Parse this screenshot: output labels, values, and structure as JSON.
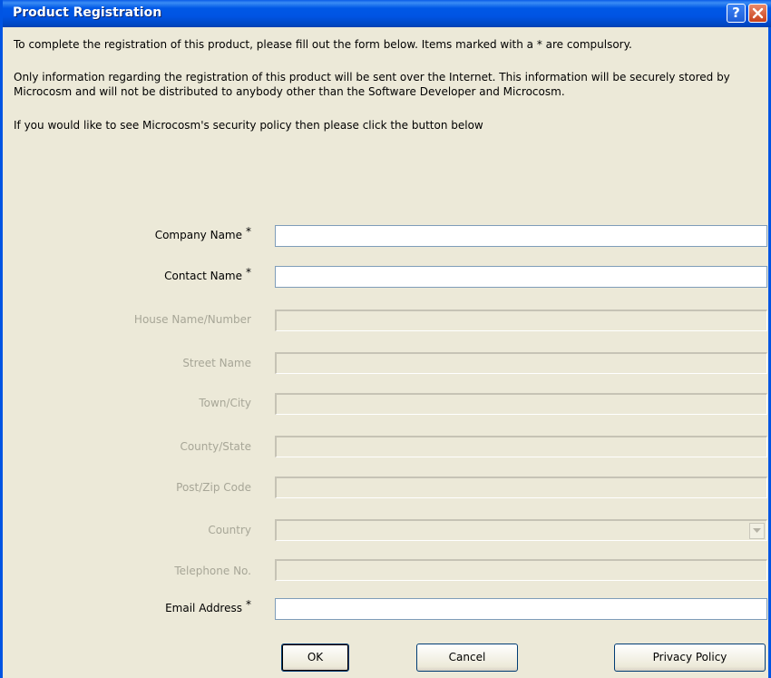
{
  "window": {
    "title": "Product Registration",
    "help_glyph": "?",
    "colors": {
      "titlebar": "#0054e3",
      "background": "#ece9d8",
      "disabled_text": "#a7a697"
    }
  },
  "intro": {
    "line1": "To complete the registration of this product, please fill out the form below. Items marked with a * are compulsory.",
    "line2": "Only information regarding the registration of this product will be sent over the Internet. This information will be securely stored by Microcosm and will not be distributed to anybody other than the Software Developer and Microcosm.",
    "line3": "If you would like to see Microcosm's security policy then please click the button below"
  },
  "form": {
    "required_marker": "*",
    "fields": [
      {
        "label": "Company Name",
        "value": "",
        "required": true,
        "enabled": true
      },
      {
        "label": "Contact Name",
        "value": "",
        "required": true,
        "enabled": true
      },
      {
        "label": "House Name/Number",
        "value": "",
        "required": false,
        "enabled": false
      },
      {
        "label": "Street Name",
        "value": "",
        "required": false,
        "enabled": false
      },
      {
        "label": "Town/City",
        "value": "",
        "required": false,
        "enabled": false
      },
      {
        "label": "County/State",
        "value": "",
        "required": false,
        "enabled": false
      },
      {
        "label": "Post/Zip Code",
        "value": "",
        "required": false,
        "enabled": false
      },
      {
        "label": "Country",
        "value": "",
        "required": false,
        "enabled": false,
        "type": "select"
      },
      {
        "label": "Telephone No.",
        "value": "",
        "required": false,
        "enabled": false
      },
      {
        "label": "Email Address",
        "value": "",
        "required": true,
        "enabled": true
      }
    ]
  },
  "buttons": {
    "ok": "OK",
    "cancel": "Cancel",
    "privacy": "Privacy Policy"
  }
}
